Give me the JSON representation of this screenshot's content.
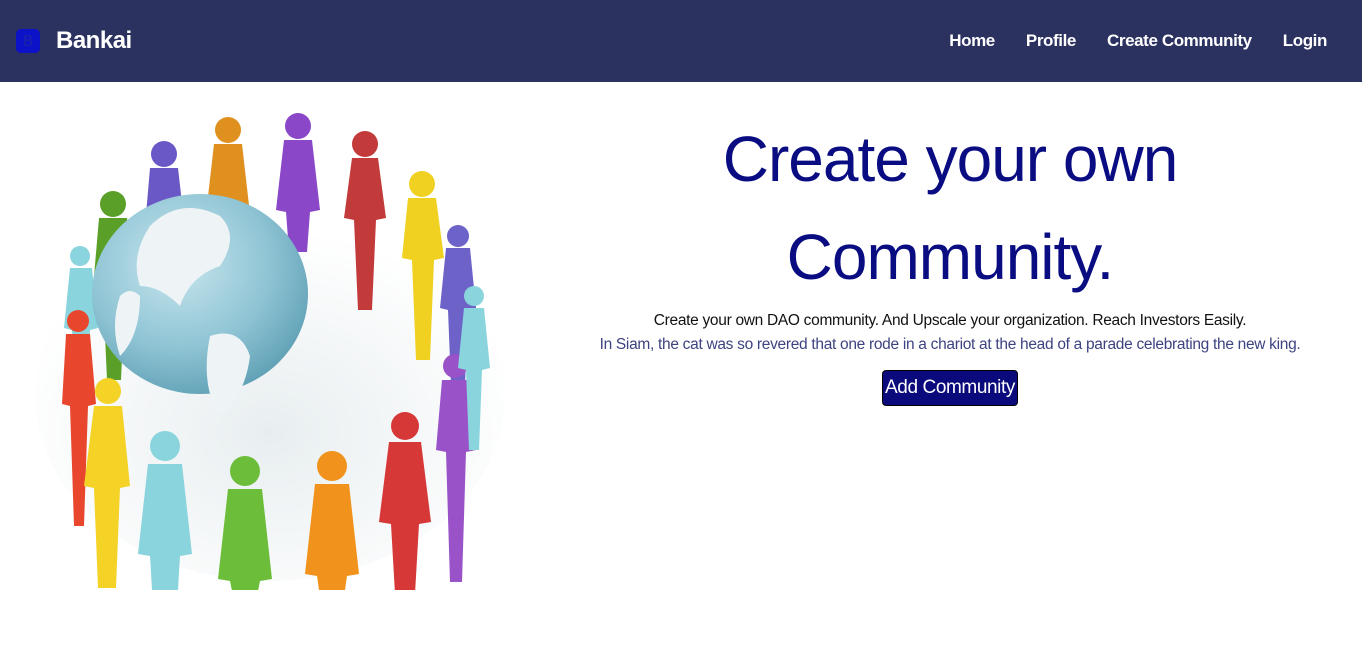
{
  "nav": {
    "brand_initial": "B",
    "brand_name": "Bankai",
    "links": [
      "Home",
      "Profile",
      "Create Community",
      "Login"
    ]
  },
  "hero": {
    "title_line1": "Create your own",
    "title_line2": "Community.",
    "subtitle": "Create your own DAO community. And Upscale your organization. Reach Investors Easily.",
    "fact": "In Siam, the cat was so revered that one rode in a chariot at the head of a parade celebrating the new king.",
    "button_label": "Add Community",
    "image_icon": "people-around-globe"
  },
  "colors": {
    "navbar": "#2b3260",
    "title": "#0a0c82",
    "button": "#0a0a7c"
  }
}
